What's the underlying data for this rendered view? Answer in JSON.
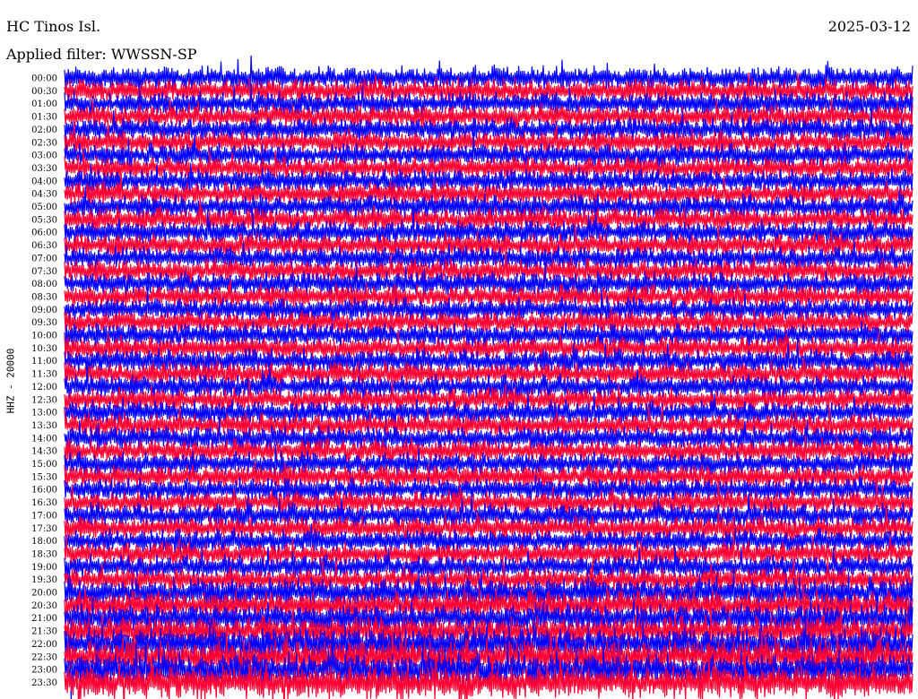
{
  "header": {
    "station": "HC Tinos Isl.",
    "date": "2025-03-12",
    "filter": "Applied filter: WWSSN-SP"
  },
  "chart_data": {
    "type": "line",
    "title": "HC Tinos Isl.",
    "subtitle": "Applied filter: WWSSN-SP",
    "ylabel": "HHZ - 20000",
    "xlabel": "",
    "y_tick_labels": [
      "00:00",
      "00:30",
      "01:00",
      "01:30",
      "02:00",
      "02:30",
      "03:00",
      "03:30",
      "04:00",
      "04:30",
      "05:00",
      "05:30",
      "06:00",
      "06:30",
      "07:00",
      "07:30",
      "08:00",
      "08:30",
      "09:00",
      "09:30",
      "10:00",
      "10:30",
      "11:00",
      "11:30",
      "12:00",
      "12:30",
      "13:00",
      "13:30",
      "14:00",
      "14:30",
      "15:00",
      "15:30",
      "16:00",
      "16:30",
      "17:00",
      "17:30",
      "18:00",
      "18:30",
      "19:00",
      "19:30",
      "20:00",
      "20:30",
      "21:00",
      "21:30",
      "22:00",
      "22:30",
      "23:00",
      "23:30"
    ],
    "trace_colors": [
      "#0000ff",
      "#ff0033"
    ],
    "rows": 48,
    "row_minutes": 30,
    "grid": false,
    "legend": "none"
  }
}
